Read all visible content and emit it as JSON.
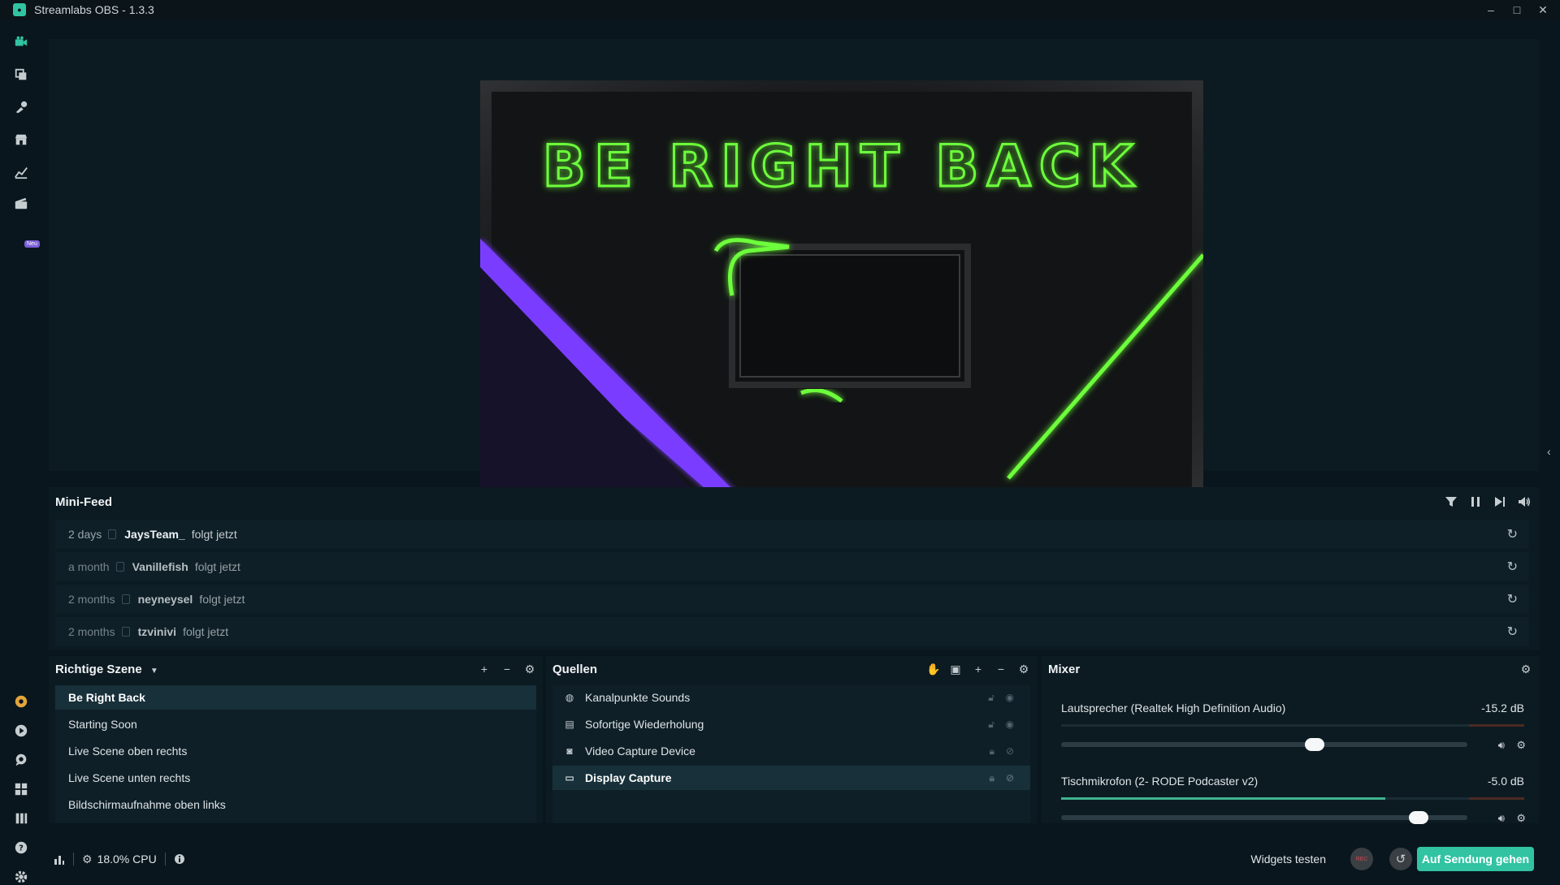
{
  "window": {
    "title": "Streamlabs OBS - 1.3.3",
    "controls": [
      "–",
      "□",
      "✕"
    ]
  },
  "sidebar": {
    "icons": [
      "video-camera-icon",
      "layers-icon",
      "themes-icon",
      "store-icon",
      "analytics-icon",
      "highlighter-icon",
      "donation-icon",
      "play-icon",
      "chat-icon",
      "layout-icon",
      "studio-mode-icon",
      "help-icon",
      "settings-icon"
    ],
    "new_badge": "Neu"
  },
  "preview": {
    "overlay_text": "BE RIGHT BACK",
    "accent_green": "#6dff3a",
    "accent_purple": "#7a3cff"
  },
  "minifeed": {
    "title": "Mini-Feed",
    "items": [
      {
        "time": "2 days",
        "user": "JaysTeam_",
        "action": "folgt jetzt"
      },
      {
        "time": "a month",
        "user": "Vanillefish",
        "action": "folgt jetzt"
      },
      {
        "time": "2 months",
        "user": "neyneysel",
        "action": "folgt jetzt"
      },
      {
        "time": "2 months",
        "user": "tzvinivi",
        "action": "folgt jetzt"
      }
    ]
  },
  "scenes": {
    "title": "Richtige Szene",
    "items": [
      "Be Right Back",
      "Starting Soon",
      "Live Scene oben rechts",
      "Live Scene unten rechts",
      "Bildschirmaufnahme oben links"
    ],
    "active_index": 0
  },
  "sources": {
    "title": "Quellen",
    "items": [
      {
        "name": "Kanalpunkte Sounds",
        "icon": "globe-icon"
      },
      {
        "name": "Sofortige Wiederholung",
        "icon": "file-icon"
      },
      {
        "name": "Video Capture Device",
        "icon": "webcam-icon"
      },
      {
        "name": "Display Capture",
        "icon": "monitor-icon"
      }
    ],
    "active_index": 3
  },
  "mixer": {
    "title": "Mixer",
    "channels": [
      {
        "name": "Lautsprecher (Realtek High Definition Audio)",
        "db": "-15.2 dB",
        "volume": 0.61,
        "level": 0.0
      },
      {
        "name": "Tischmikrofon (2- RODE Podcaster v2)",
        "db": "-5.0 dB",
        "volume": 0.86,
        "level": 0.7
      }
    ]
  },
  "footer": {
    "cpu": "18.0% CPU",
    "widgets_test": "Widgets testen",
    "rec": "REC",
    "go_live": "Auf Sendung gehen"
  },
  "colors": {
    "background": "#09161d",
    "panel": "#0c1b22",
    "accent": "#31c3a2"
  }
}
